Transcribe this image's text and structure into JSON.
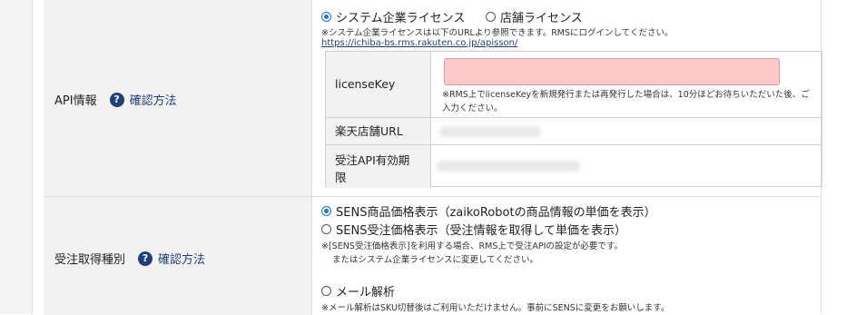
{
  "api_row": {
    "label": "API情報",
    "help_icon": "?",
    "confirm_label": "確認方法",
    "options": [
      {
        "label": "システム企業ライセンス",
        "checked": true
      },
      {
        "label": "店舗ライセンス",
        "checked": false
      }
    ],
    "note": "※システム企業ライセンスは以下のURLより参照できます。RMSにログインしてください。",
    "link": "https://ichiba-bs.rms.rakuten.co.jp/apisson/",
    "fields": {
      "license_label": "licenseKey",
      "license_note": "※RMS上でlicenseKeyを新規発行または再発行した場合は、10分ほどお待ちいただいた後、ご入力ください。",
      "store_url_label": "楽天店舗URL",
      "expiry_label_line1": "受注API有効期",
      "expiry_label_line2": "限"
    }
  },
  "order_row": {
    "label": "受注取得種別",
    "help_icon": "?",
    "confirm_label": "確認方法",
    "options": [
      {
        "label": "SENS商品価格表示（zaikoRobotの商品情報の単価を表示）",
        "checked": true
      },
      {
        "label": "SENS受注価格表示（受注情報を取得して単価を表示）",
        "checked": false
      }
    ],
    "note_line1": "※[SENS受注価格表示]を利用する場合、RMS上で受注APIの設定が必要です。",
    "note_line2": "またはシステム企業ライセンスに変更してください。",
    "mail_option": {
      "label": "メール解析",
      "checked": false
    },
    "mail_note": "※メール解析はSKU切替後はご利用いただけません。事前にSENSに変更をお願いします。"
  }
}
